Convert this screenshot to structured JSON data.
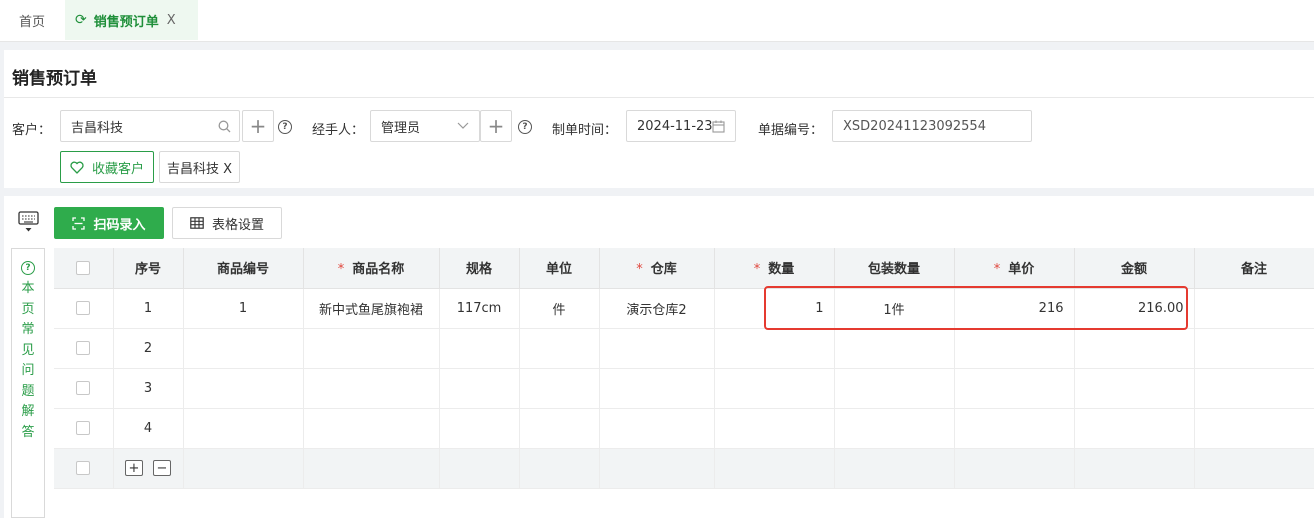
{
  "tabs": [
    {
      "label": "首页"
    },
    {
      "label": "销售预订单",
      "close": "X"
    }
  ],
  "page_title": "销售预订单",
  "form": {
    "customer_label": "客户：",
    "customer_value": "吉昌科技",
    "handler_label": "经手人：",
    "handler_value": "管理员",
    "date_label": "制单时间：",
    "date_value": "2024-11-23",
    "doc_no_label": "单据编号：",
    "doc_no_value": "XSD20241123092554",
    "fav_button": "收藏客户",
    "customer_tag": "吉昌科技 X"
  },
  "toolbar": {
    "scan_label": "扫码录入",
    "settings_label": "表格设置"
  },
  "faq": {
    "text": "本页常见问题解答"
  },
  "table": {
    "headers": [
      "序号",
      "商品编号",
      "商品名称",
      "规格",
      "单位",
      "仓库",
      "数量",
      "包装数量",
      "单价",
      "金额",
      "备注"
    ],
    "rows": [
      {
        "seq": "1",
        "code": "1",
        "name": "新中式鱼尾旗袍裙",
        "spec": "117cm",
        "unit": "件",
        "warehouse": "演示仓库2",
        "qty": "1",
        "pack": "1件",
        "price": "216",
        "amount": "216.00",
        "remark": ""
      },
      {
        "seq": "2"
      },
      {
        "seq": "3"
      },
      {
        "seq": "4"
      }
    ]
  },
  "colors": {
    "accent": "#2fac4c",
    "highlight": "#e53a30"
  }
}
